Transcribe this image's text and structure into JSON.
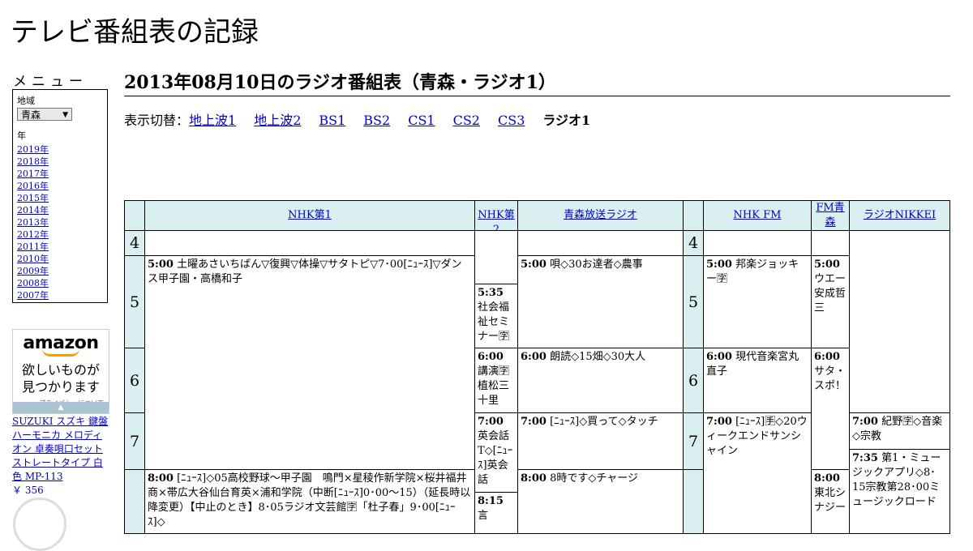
{
  "site_title": "テレビ番組表の記録",
  "menu": {
    "title": "メニュー",
    "region_label": "地域",
    "region_value": "青森",
    "year_label": "年",
    "years": [
      "2019年",
      "2018年",
      "2017年",
      "2016年",
      "2015年",
      "2014年",
      "2013年",
      "2012年",
      "2011年",
      "2010年",
      "2009年",
      "2008年",
      "2007年"
    ]
  },
  "ad": {
    "logo": "amazon",
    "tagline_1": "欲しいものが",
    "tagline_2": "見つかります",
    "privacy": "プライバシーについて",
    "product": "SUZUKI スズキ 鍵盤ハーモニカ メロディオン 卓奏唄口セット ストレートタイプ 白色 MP-113",
    "price": "￥ 356"
  },
  "page_heading": "2013年08月10日のラジオ番組表（青森・ラジオ1）",
  "switcher": {
    "label": "表示切替：",
    "links": [
      "地上波1",
      "地上波2",
      "BS1",
      "BS2",
      "CS1",
      "CS2",
      "CS3"
    ],
    "current": "ラジオ1"
  },
  "channels": [
    "NHK第1",
    "NHK第2",
    "青森放送ラジオ",
    "NHK FM",
    "FM青森",
    "ラジオNIKKEI"
  ],
  "hours": [
    "4",
    "5",
    "6",
    "7"
  ],
  "programs": {
    "nhk1_a_time": "5:00",
    "nhk1_a_title": "土曜あさいちばん▽復興▽体操▽サタトピ▽7･00[ﾆｭｰｽ]▽ダンス甲子園・高橋和子",
    "nhk1_b_time": "8:00",
    "nhk1_b_title": "[ﾆｭｰｽ]◇05高校野球〜甲子園　鳴門×星稜作新学院×桜井福井商×帯広大谷仙台育英×浦和学院（中断[ﾆｭｰｽ]0･00〜15）（延長時以降変更）【中止のとき】8･05ラジオ文芸館🈑「杜子春」9･00[ﾆｭｰｽ]◇",
    "nhk2_a_time": "5:35",
    "nhk2_a_title": "社会福祉セミナー🈑",
    "nhk2_b_time": "6:00",
    "nhk2_b_title": "講演🈑植松三十里",
    "nhk2_c_time": "7:00",
    "nhk2_c_title": "英会話T◇[ﾆｭｰｽ]英会話",
    "nhk2_d_time": "8:15",
    "nhk2_d_title": "言",
    "rab_a_time": "5:00",
    "rab_a_title": "唄◇30お達者◇農事",
    "rab_b_time": "6:00",
    "rab_b_title": "朗読◇15畑◇30大人",
    "rab_c_time": "7:00",
    "rab_c_title": "[ﾆｭｰｽ]◇買って◇タッチ",
    "rab_d_time": "8:00",
    "rab_d_title": "8時です◇チャージ",
    "fm_a_time": "5:00",
    "fm_a_title": "邦楽ジョッキー🈑",
    "fm_b_time": "6:00",
    "fm_b_title": "現代音楽宮丸直子",
    "fm_c_time": "7:00",
    "fm_c_title": "[ﾆｭｰｽ]🈐◇20ウィークエンドサンシャイン",
    "fma_a_time": "5:00",
    "fma_a_title": "ウエー安成哲三",
    "fma_b_time": "6:00",
    "fma_b_title": "サタ・スポ！",
    "fma_c_time": "8:00",
    "fma_c_title": "東北シナジー",
    "nikkei_a_time": "7:00",
    "nikkei_a_title": "紀野🈑◇音楽◇宗教",
    "nikkei_b_time": "7:35",
    "nikkei_b_title": "第1・ミュージックアプリ◇8･15宗教第28･00ミュージックロード"
  }
}
